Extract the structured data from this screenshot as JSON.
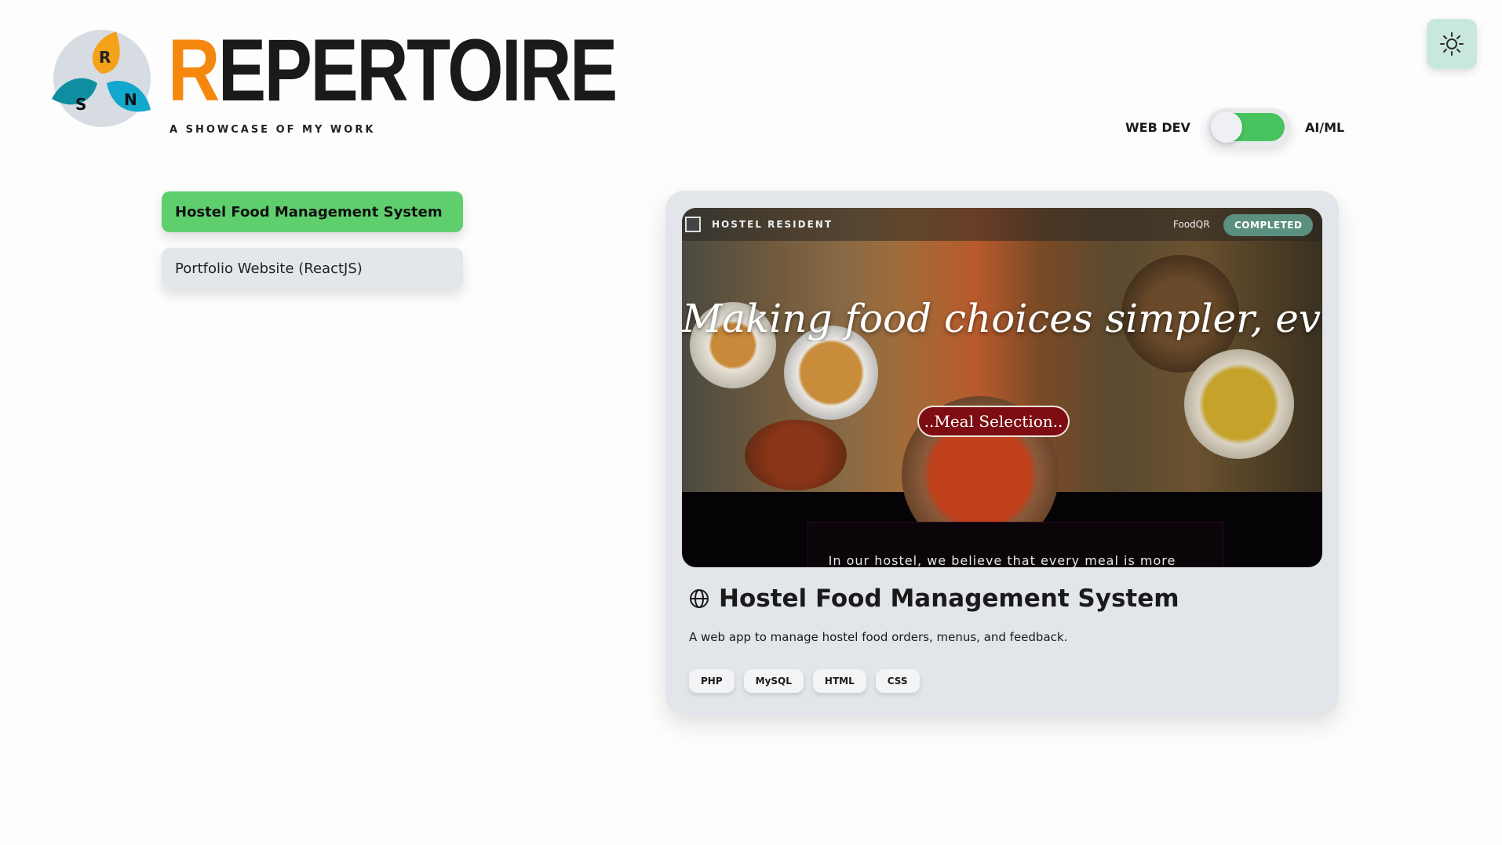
{
  "brand": {
    "title_first": "R",
    "title_rest": "EPERTOIRE",
    "subtitle": "A SHOWCASE OF MY WORK",
    "logo_letters": [
      "R",
      "S",
      "N"
    ]
  },
  "theme_toggle": {
    "icon": "sun-icon"
  },
  "mode_toggle": {
    "left_label": "WEB DEV",
    "right_label": "AI/ML",
    "state": "AI/ML"
  },
  "projects": [
    {
      "label": "Hostel Food Management System",
      "active": true
    },
    {
      "label": "Portfolio Website (ReactJS)",
      "active": false
    }
  ],
  "card": {
    "preview": {
      "header_brand": "HOSTEL RESIDENT",
      "header_link": "FoodQR",
      "status": "COMPLETED",
      "tagline": "Making food choices simpler, every day",
      "button": "..Meal Selection..",
      "intro": "In our hostel, we believe that every meal is more"
    },
    "title": "Hostel Food Management System",
    "description": "A web app to manage hostel food orders, menus, and feedback.",
    "tags": [
      "PHP",
      "MySQL",
      "HTML",
      "CSS"
    ]
  },
  "colors": {
    "accent_orange": "#f5870f",
    "active_green": "#5fcf6e",
    "toggle_green": "#48c45e",
    "status_teal": "#5b8f80",
    "meal_button_red": "#7d0d12"
  }
}
